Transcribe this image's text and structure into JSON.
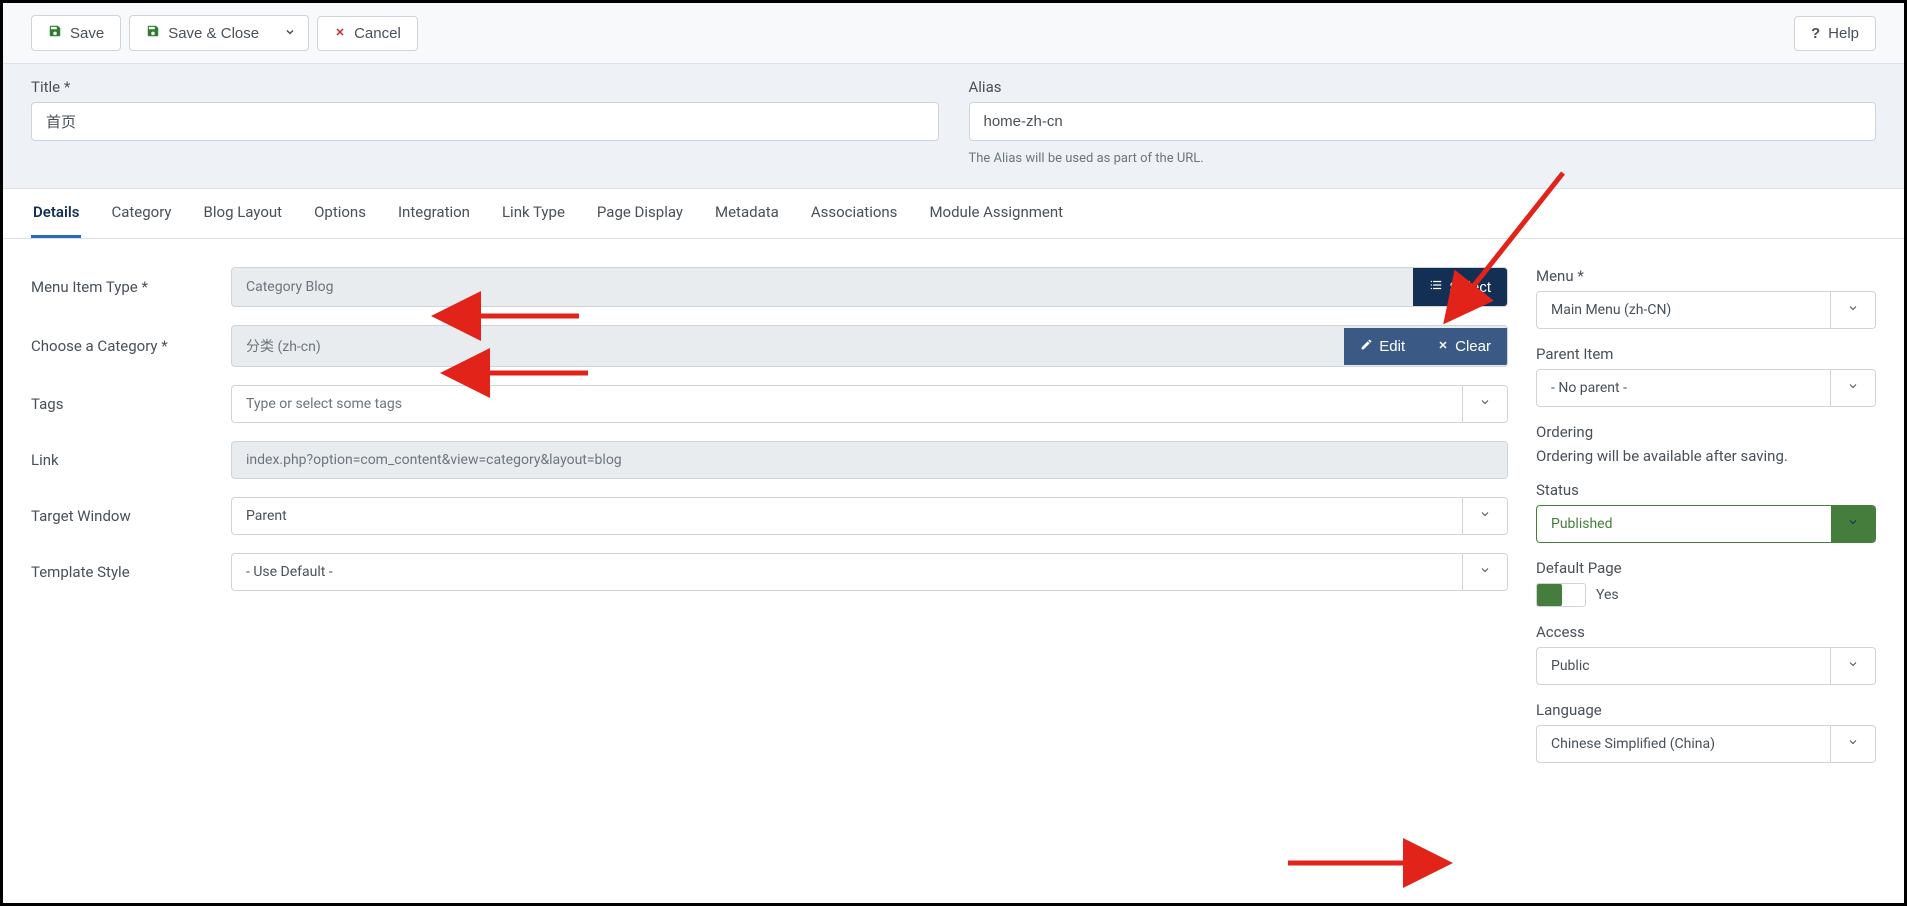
{
  "toolbar": {
    "save": "Save",
    "saveClose": "Save & Close",
    "cancel": "Cancel",
    "help": "Help"
  },
  "titleSection": {
    "titleLabel": "Title *",
    "titleValue": "首页",
    "aliasLabel": "Alias",
    "aliasValue": "home-zh-cn",
    "aliasHint": "The Alias will be used as part of the URL."
  },
  "tabs": [
    "Details",
    "Category",
    "Blog Layout",
    "Options",
    "Integration",
    "Link Type",
    "Page Display",
    "Metadata",
    "Associations",
    "Module Assignment"
  ],
  "activeTab": "Details",
  "fields": {
    "menuItemType": {
      "label": "Menu Item Type *",
      "value": "Category Blog",
      "selectBtn": "Select"
    },
    "category": {
      "label": "Choose a Category *",
      "value": "分类 (zh-cn)",
      "editBtn": "Edit",
      "clearBtn": "Clear"
    },
    "tags": {
      "label": "Tags",
      "placeholder": "Type or select some tags"
    },
    "link": {
      "label": "Link",
      "value": "index.php?option=com_content&view=category&layout=blog"
    },
    "targetWindow": {
      "label": "Target Window",
      "value": "Parent"
    },
    "templateStyle": {
      "label": "Template Style",
      "value": "- Use Default -"
    }
  },
  "rightFields": {
    "menu": {
      "label": "Menu *",
      "value": "Main Menu (zh-CN)"
    },
    "parentItem": {
      "label": "Parent Item",
      "value": "- No parent -"
    },
    "ordering": {
      "label": "Ordering",
      "hint": "Ordering will be available after saving."
    },
    "status": {
      "label": "Status",
      "value": "Published"
    },
    "defaultPage": {
      "label": "Default Page",
      "value": "Yes"
    },
    "access": {
      "label": "Access",
      "value": "Public"
    },
    "language": {
      "label": "Language",
      "value": "Chinese Simplified (China)"
    }
  }
}
